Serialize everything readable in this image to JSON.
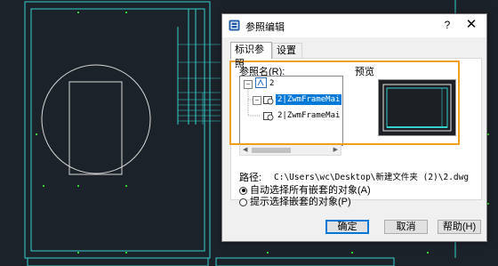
{
  "dialog": {
    "title": "参照编辑",
    "help_glyph": "?",
    "close_glyph": "✕",
    "tabs": [
      {
        "label": "标识参照",
        "active": true
      },
      {
        "label": "设置",
        "active": false
      }
    ],
    "reference_label": "参照名(R):",
    "preview_label": "预览",
    "tree": {
      "root": {
        "label": "2",
        "expander": "−"
      },
      "children": [
        {
          "label": "2|ZwmFrameMai",
          "selected": true,
          "expander": "−"
        },
        {
          "label": "2|ZwmFrameMai",
          "selected": false
        }
      ]
    },
    "path": {
      "label": "路径:",
      "value": "C:\\Users\\wc\\Desktop\\新建文件夹 (2)\\2.dwg"
    },
    "options": [
      {
        "label": "自动选择所有嵌套的对象(A)",
        "checked": true
      },
      {
        "label": "提示选择嵌套的对象(P)",
        "checked": false
      }
    ],
    "buttons": {
      "ok": "确定",
      "cancel": "取消",
      "help": "帮助(H)"
    }
  },
  "colors": {
    "cad_background": "#1c2229",
    "drawing_line": "#34d0d0",
    "highlight": "#f0a020",
    "selection": "#0078d7"
  },
  "icons": [
    "app-icon",
    "help-icon",
    "close-icon",
    "drawing-icon",
    "xref-icon"
  ]
}
